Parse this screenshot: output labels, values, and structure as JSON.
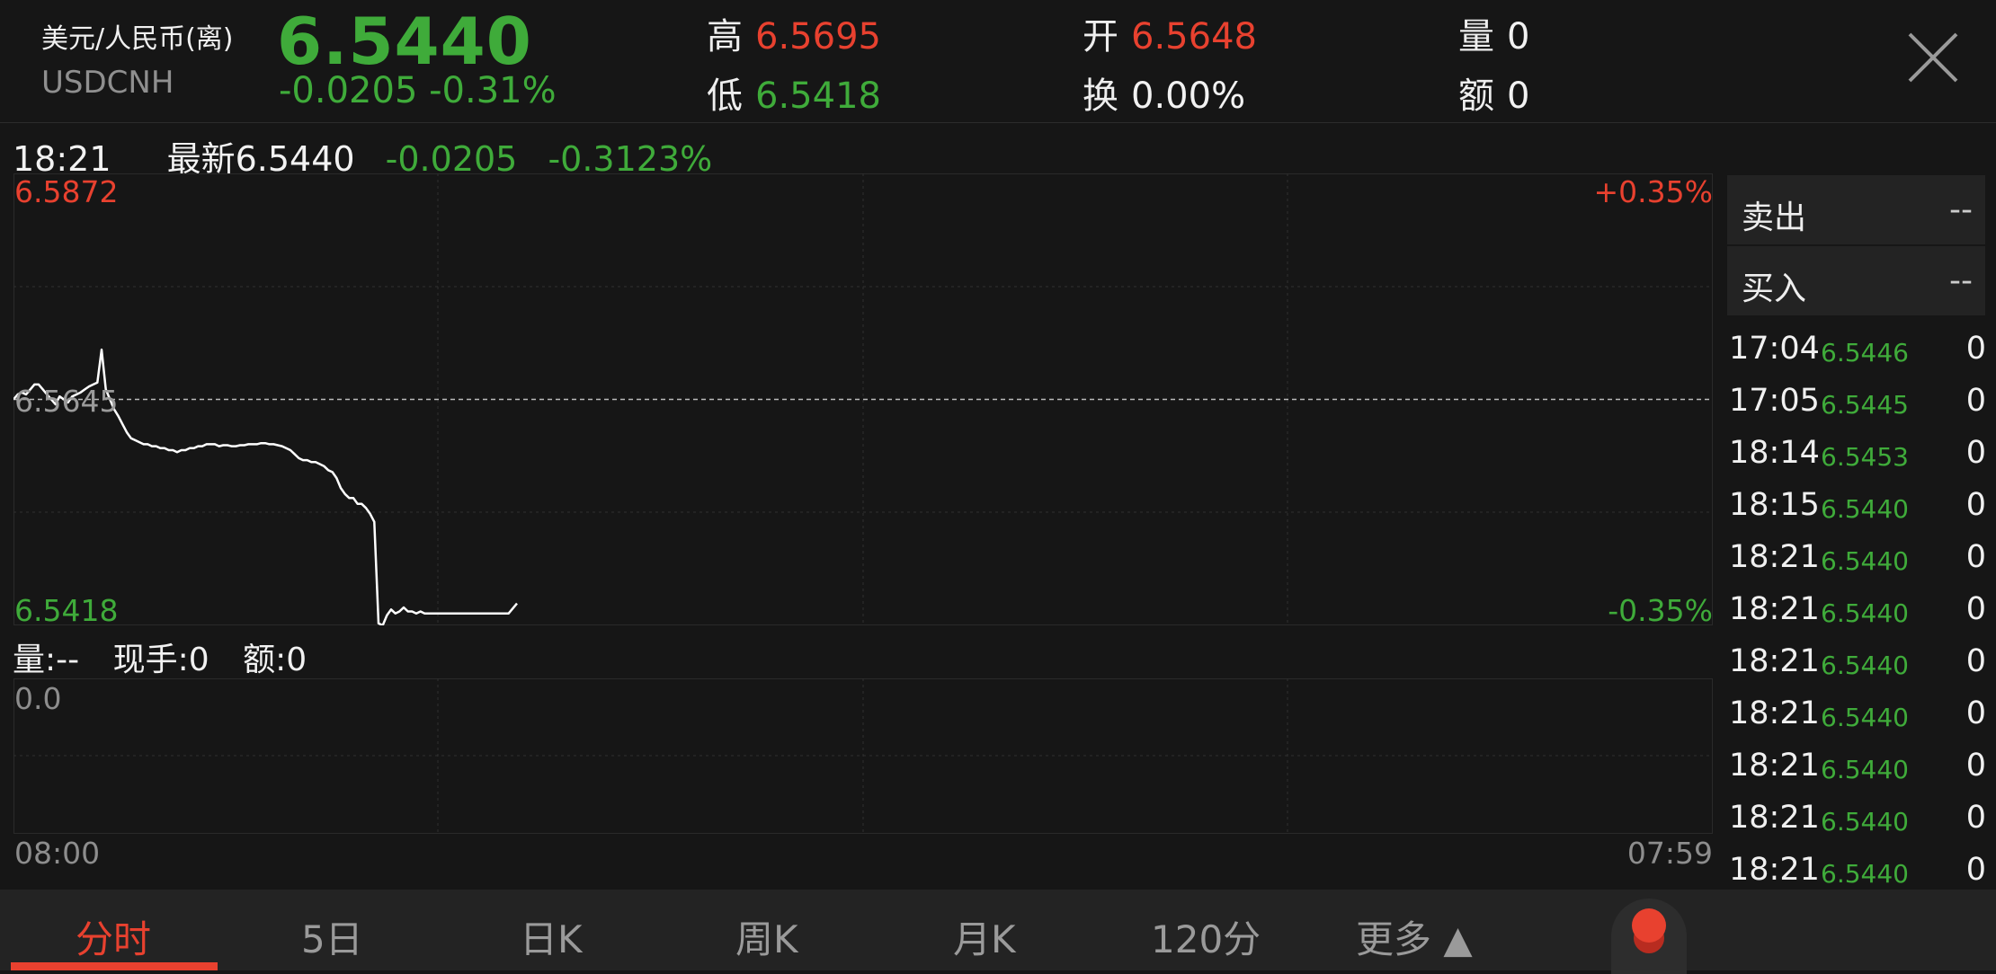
{
  "header": {
    "name": "美元/人民币(离)",
    "code": "USDCNH",
    "price": "6.5440",
    "change": "-0.0205 -0.31%",
    "stats": [
      {
        "label": "高",
        "value": "6.5695",
        "tone": "up"
      },
      {
        "label": "开",
        "value": "6.5648",
        "tone": "up"
      },
      {
        "label": "量",
        "value": "0",
        "tone": "white"
      },
      {
        "label": "低",
        "value": "6.5418",
        "tone": "down"
      },
      {
        "label": "换",
        "value": "0.00%",
        "tone": "white"
      },
      {
        "label": "额",
        "value": "0",
        "tone": "white"
      }
    ]
  },
  "info_line": {
    "time": "18:21",
    "latest": "最新6.5440",
    "change": "-0.0205",
    "change_pct": "-0.3123%"
  },
  "price_chart": {
    "y_max_label": "6.5872",
    "y_min_label": "6.5418",
    "prev_close_label": "6.5645",
    "pct_max_label": "+0.35%",
    "pct_min_label": "-0.35%",
    "x_start_label": "08:00",
    "x_end_label": "07:59"
  },
  "volume_bar": {
    "vol": "量:--",
    "hand": "现手:0",
    "amount": "额:0",
    "y_label": "0.0"
  },
  "chart_data": {
    "type": "line",
    "series": [
      {
        "values": [
          6.5645,
          6.565,
          6.5652,
          6.565,
          6.5655,
          6.566,
          6.566,
          6.5655,
          6.565,
          6.5645,
          6.564,
          6.5648,
          6.5645,
          6.5642,
          6.5648,
          6.565,
          6.5652,
          6.5655,
          6.5658,
          6.566,
          6.5662,
          6.5695,
          6.5655,
          6.5645,
          6.5635,
          6.5628,
          6.562,
          6.5612,
          6.5606,
          6.5604,
          6.5602,
          6.56,
          6.56,
          6.5598,
          6.5598,
          6.5596,
          6.5596,
          6.5594,
          6.5594,
          6.5592,
          6.5594,
          6.5594,
          6.5596,
          6.5596,
          6.5598,
          6.5598,
          6.56,
          6.56,
          6.56,
          6.5598,
          6.5599,
          6.5599,
          6.5598,
          6.5598,
          6.5599,
          6.5599,
          6.56,
          6.56,
          6.56,
          6.5601,
          6.5601,
          6.56,
          6.56,
          6.5599,
          6.5598,
          6.5596,
          6.5594,
          6.559,
          6.5586,
          6.5584,
          6.5584,
          6.5582,
          6.5582,
          6.558,
          6.5578,
          6.5574,
          6.5572,
          6.5566,
          6.5556,
          6.555,
          6.5546,
          6.5546,
          6.554,
          6.554,
          6.5536,
          6.553,
          6.5522,
          6.542,
          6.5418,
          6.5428,
          6.5434,
          6.543,
          6.5432,
          6.5436,
          6.5432,
          6.5432,
          6.543,
          6.5432,
          6.543,
          6.543,
          6.543,
          6.543,
          6.543,
          6.543,
          6.543,
          6.543,
          6.543,
          6.543,
          6.543,
          6.543,
          6.543,
          6.543,
          6.543,
          6.543,
          6.543,
          6.543,
          6.543,
          6.543,
          6.543,
          6.5435,
          6.544
        ]
      }
    ],
    "x_range": [
      "08:00",
      "07:59"
    ],
    "ylim": [
      6.5418,
      6.5872
    ],
    "prev_close": 6.5645,
    "grid": true
  },
  "right_panel": {
    "sell_label": "卖出",
    "sell_value": "--",
    "buy_label": "买入",
    "buy_value": "--",
    "ticks": [
      {
        "time": "17:04",
        "price": "6.5446",
        "vol": "0"
      },
      {
        "time": "17:05",
        "price": "6.5445",
        "vol": "0"
      },
      {
        "time": "18:14",
        "price": "6.5453",
        "vol": "0"
      },
      {
        "time": "18:15",
        "price": "6.5440",
        "vol": "0"
      },
      {
        "time": "18:21",
        "price": "6.5440",
        "vol": "0"
      },
      {
        "time": "18:21",
        "price": "6.5440",
        "vol": "0"
      },
      {
        "time": "18:21",
        "price": "6.5440",
        "vol": "0"
      },
      {
        "time": "18:21",
        "price": "6.5440",
        "vol": "0"
      },
      {
        "time": "18:21",
        "price": "6.5440",
        "vol": "0"
      },
      {
        "time": "18:21",
        "price": "6.5440",
        "vol": "0"
      },
      {
        "time": "18:21",
        "price": "6.5440",
        "vol": "0"
      }
    ]
  },
  "tabs": [
    {
      "label": "分时",
      "active": true
    },
    {
      "label": "5日",
      "active": false
    },
    {
      "label": "日K",
      "active": false
    },
    {
      "label": "周K",
      "active": false
    },
    {
      "label": "月K",
      "active": false
    },
    {
      "label": "120分",
      "active": false
    },
    {
      "label": "更多 ▲",
      "active": false
    }
  ],
  "colors": {
    "up": "#e8412f",
    "down": "#3fab3a",
    "background": "#161616",
    "line": "#ffffff"
  }
}
